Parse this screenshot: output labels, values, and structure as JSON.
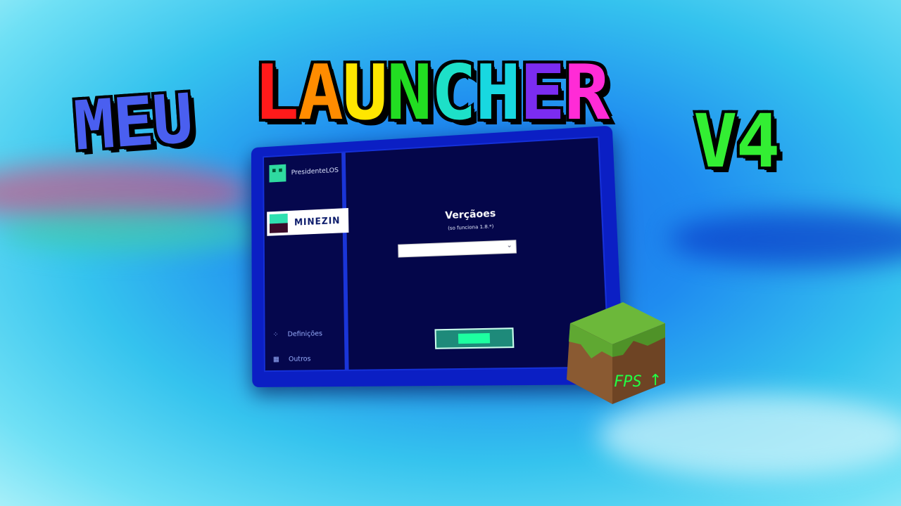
{
  "headline": {
    "prefix": "MEU",
    "prefix_color": "#4a5ff0",
    "word_letters": [
      {
        "char": "L",
        "color": "#ff1a1a"
      },
      {
        "char": "A",
        "color": "#ff8c00"
      },
      {
        "char": "U",
        "color": "#ffe600"
      },
      {
        "char": "N",
        "color": "#22dd22"
      },
      {
        "char": "C",
        "color": "#1de0c8"
      },
      {
        "char": "H",
        "color": "#18d8e0"
      },
      {
        "char": "E",
        "color": "#7b2cf0"
      },
      {
        "char": "R",
        "color": "#ff2bd6"
      }
    ],
    "version": "V4",
    "version_color": "#33ee33"
  },
  "launcher": {
    "profile_name": "PresidenteLOS",
    "server_button": "MINEZIN",
    "versions_title": "Verçãoes",
    "versions_note": "(so funciona 1.8.*)",
    "version_select_value": "",
    "settings_label": "Definições",
    "others_label": "Outros"
  },
  "badge": {
    "text": "FPS",
    "icon": "arrow-up-icon"
  }
}
